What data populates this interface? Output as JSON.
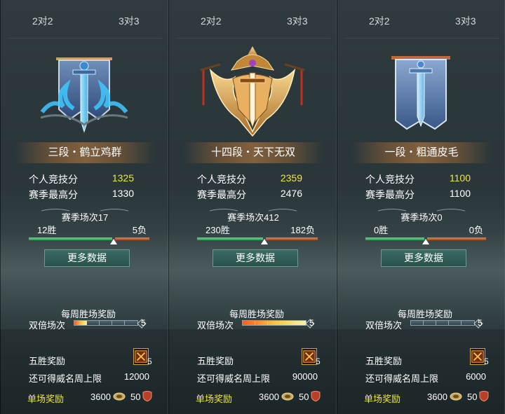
{
  "tabs": {
    "left": "2对2",
    "right": "3对3"
  },
  "labels": {
    "personal_score": "个人竞技分",
    "season_high": "赛季最高分",
    "more_data": "更多数据",
    "weekly_reward": "每周胜场奖励",
    "double_count": "双倍场次",
    "five_win_reward": "五胜奖励",
    "fame_cap": "还可得威名周上限",
    "single_reward": "单场奖励"
  },
  "panels": [
    {
      "rank": "三段・鹤立鸡群",
      "emblem": "blue-dragon-sword-banner-icon",
      "personal_score": "1325",
      "season_high": "1330",
      "season_games": "赛季场次17",
      "wins": "12胜",
      "losses": "5负",
      "win_ratio": 0.706,
      "double_count": "5",
      "double_progress": 0.2,
      "chest_count": "5",
      "fame_cap": "12000",
      "single_value_1": "3600",
      "single_value_2": "50"
    },
    {
      "rank": "十四段・天下无双",
      "emblem": "golden-winged-sword-crest-icon",
      "personal_score": "2359",
      "season_high": "2476",
      "season_games": "赛季场次412",
      "wins": "230胜",
      "losses": "182负",
      "win_ratio": 0.558,
      "double_count": "5",
      "double_progress": 1.0,
      "chest_count": "5",
      "fame_cap": "90000",
      "single_value_1": "3600",
      "single_value_2": "50"
    },
    {
      "rank": "一段・粗通皮毛",
      "emblem": "plain-sword-banner-icon",
      "personal_score": "1100",
      "season_high": "1100",
      "season_games": "赛季场次0",
      "wins": "0胜",
      "losses": "0负",
      "win_ratio": 0.5,
      "double_count": "5",
      "double_progress": 0.0,
      "chest_count": "5",
      "fame_cap": "6000",
      "single_value_1": "3600",
      "single_value_2": "50"
    }
  ],
  "colors": {
    "gold_text": "#f3e63a",
    "win_green": "#2f9a54",
    "loss_orange": "#9a4b2a",
    "button_teal": "#2a524d"
  }
}
